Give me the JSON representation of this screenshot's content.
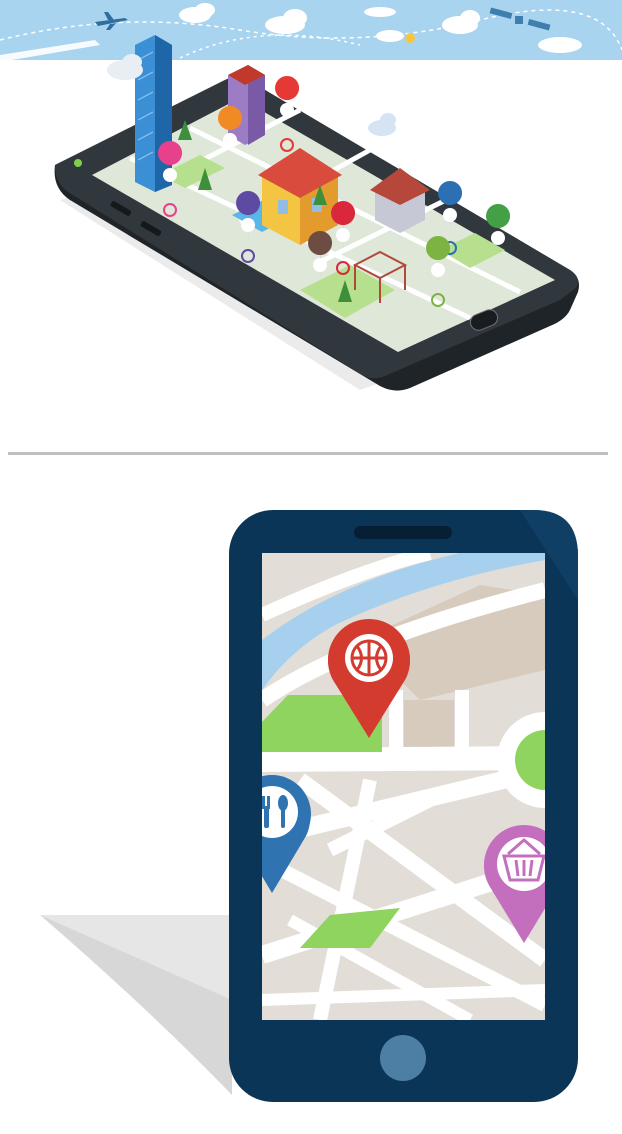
{
  "colors": {
    "sky": "#a9d4f0",
    "phone_frame_dark": "#0b3556",
    "map_background": "#e2ddd6",
    "road": "#ffffff",
    "water": "#a7d0ef",
    "park": "#8fd45e",
    "divider": "#c0c0c0",
    "pin_basketball": "#d33b2f",
    "pin_restaurant": "#2f74b1",
    "pin_shopping": "#c46fbd",
    "home_button": "#4d7ea3"
  },
  "icons": {
    "top_pins": [
      "food-pin-icon",
      "shopping-pin-icon",
      "fuel-pin-icon",
      "car-pin-icon",
      "parking-pin-icon",
      "cafe-pin-icon",
      "bank-pin-icon",
      "restaurant-pin-icon",
      "bicycle-pin-icon"
    ],
    "bottom_pins": [
      "basketball-pin-icon",
      "restaurant-pin-icon",
      "shopping-basket-pin-icon"
    ]
  }
}
